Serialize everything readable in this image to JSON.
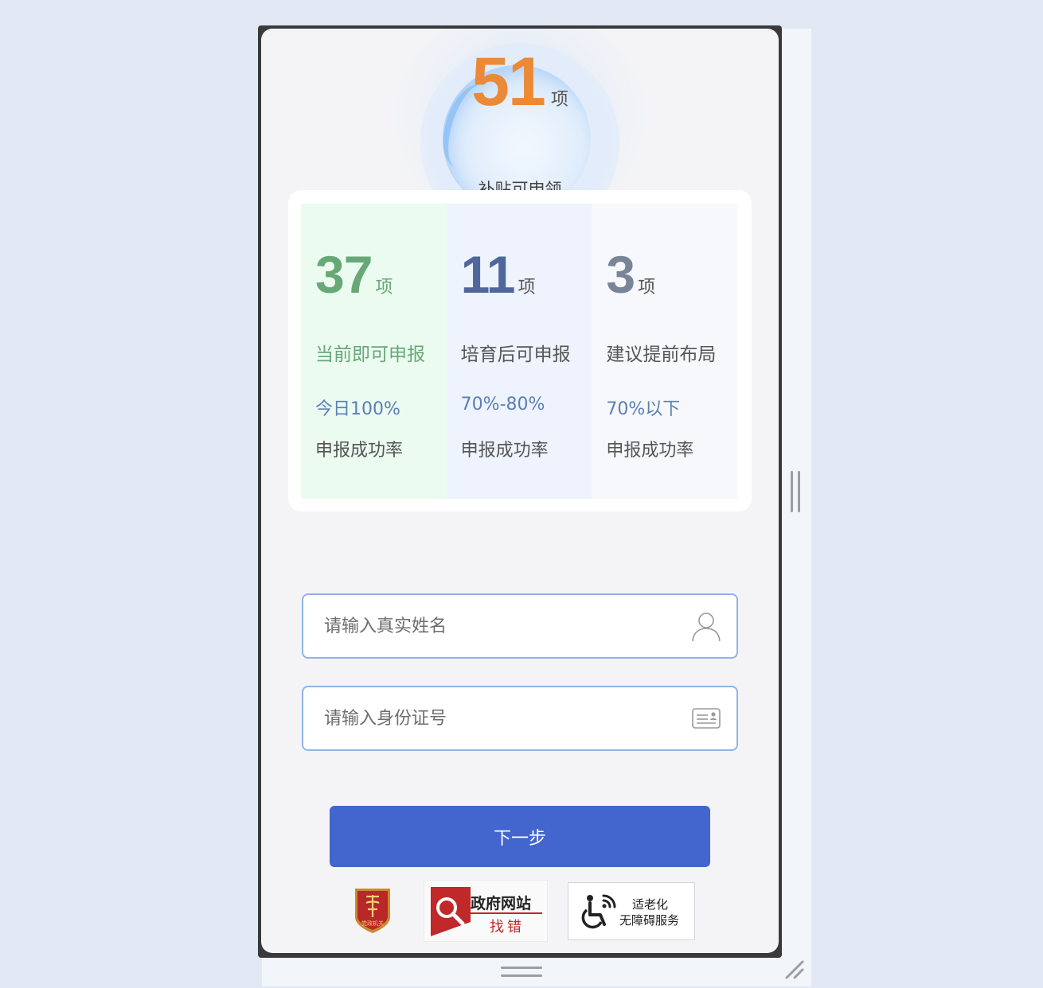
{
  "hero": {
    "count": "51",
    "unit": "项",
    "caption": "补贴可申领"
  },
  "stats": [
    {
      "count": "37",
      "unit": "项",
      "label": "当前即可申报",
      "rate": "今日100%",
      "rate_label": "申报成功率"
    },
    {
      "count": "11",
      "unit": "项",
      "label": "培育后可申报",
      "rate": "70%-80%",
      "rate_label": "申报成功率"
    },
    {
      "count": "3",
      "unit": "项",
      "label": "建议提前布局",
      "rate": "70%以下",
      "rate_label": "申报成功率"
    }
  ],
  "form": {
    "name_placeholder": "请输入真实姓名",
    "id_placeholder": "请输入身份证号",
    "next_label": "下一步"
  },
  "footer": {
    "party_badge_text": "党政机关",
    "gov_badge_title": "政府网站",
    "gov_badge_sub": "找错",
    "access_badge_line1": "适老化",
    "access_badge_line2": "无障碍服务"
  },
  "colors": {
    "accent_blue": "#4266cd",
    "hero_orange": "#ea8a36",
    "green": "#67a876",
    "input_border": "#90b4e8"
  },
  "icons": {
    "name_field": "user-icon",
    "id_field": "id-card-icon",
    "accessibility": "wheelchair-icon"
  }
}
